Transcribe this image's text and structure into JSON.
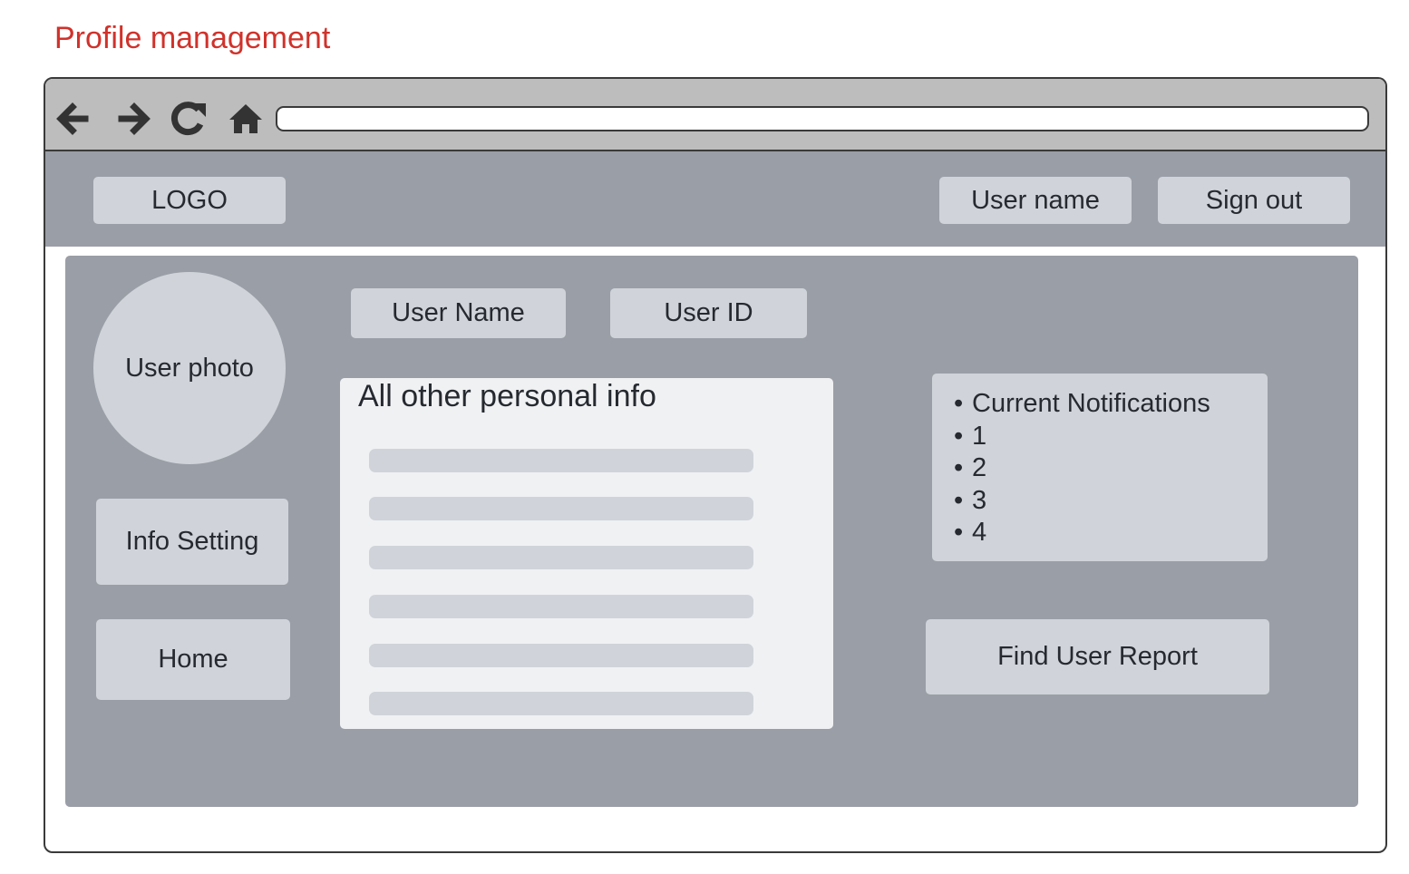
{
  "page": {
    "title": "Profile management",
    "title_color": "#d0322b"
  },
  "browser": {
    "nav_icons": [
      "back-arrow-icon",
      "forward-arrow-icon",
      "reload-icon",
      "home-icon"
    ],
    "address_value": ""
  },
  "header": {
    "logo_label": "LOGO",
    "username_label": "User name",
    "signout_label": "Sign out"
  },
  "sidebar": {
    "photo_label": "User photo",
    "info_setting_label": "Info Setting",
    "home_label": "Home"
  },
  "profile": {
    "user_name_label": "User Name",
    "user_id_label": "User ID",
    "info_title": "All other personal info"
  },
  "notifications": {
    "bullet": "•",
    "title": "Current Notifications",
    "items": [
      "1",
      "2",
      "3",
      "4"
    ]
  },
  "actions": {
    "find_report_label": "Find User Report"
  },
  "colors": {
    "panel": "#9a9ea6",
    "control": "#d0d4da",
    "card": "#f0f1f3",
    "toolbar": "#bdbdbd"
  }
}
